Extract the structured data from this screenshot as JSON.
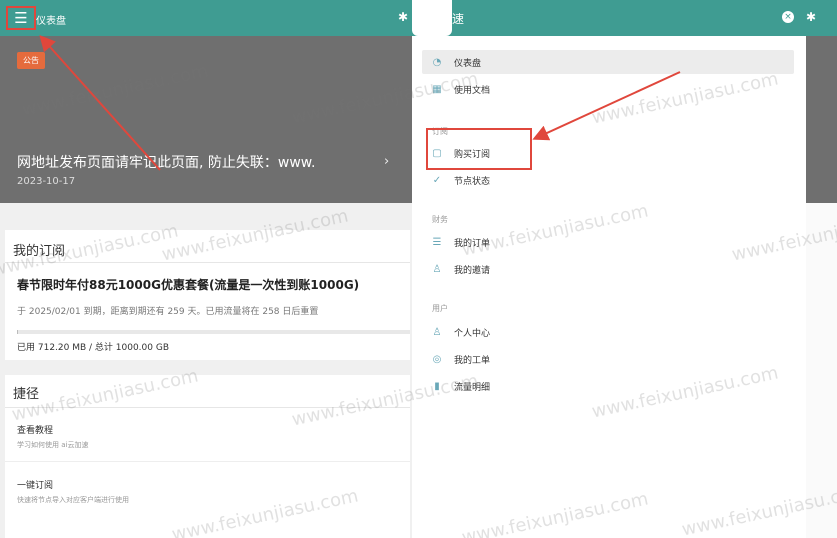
{
  "topbar": {
    "brand": "仪表盘",
    "menu_icon": "☰",
    "settings_icon": "✱"
  },
  "hero": {
    "badge": "公告",
    "title": "网地址发布页面请牢记此页面, 防止失联：www.",
    "date": "2023-10-17",
    "next_icon": "›"
  },
  "subscription": {
    "header": "我的订阅",
    "plan_name": "春节限时年付88元1000G优惠套餐(流量是一次性到账1000G)",
    "info": "于 2025/02/01 到期，距离到期还有 259 天。已用流量将在 258 日后重置",
    "usage": "已用 712.20 MB / 总计 1000.00 GB",
    "used_fraction": 0.0007
  },
  "shortcuts": {
    "header": "捷径",
    "items": [
      {
        "title": "查看教程",
        "desc": "学习如何使用 ai云加速"
      },
      {
        "title": "一键订阅",
        "desc": "快速将节点导入对应客户端进行使用"
      }
    ]
  },
  "drawer": {
    "title": "速",
    "close_icon": "×",
    "items_top": [
      {
        "label": "仪表盘",
        "icon": "◔",
        "active": true
      },
      {
        "label": "使用文档",
        "icon": "▦",
        "active": false
      }
    ],
    "section_subscribe": "订阅",
    "items_subscribe": [
      {
        "label": "购买订阅",
        "icon": "▢"
      },
      {
        "label": "节点状态",
        "icon": "✓"
      }
    ],
    "section_finance": "财务",
    "items_finance": [
      {
        "label": "我的订单",
        "icon": "☰"
      },
      {
        "label": "我的邀请",
        "icon": "♙"
      }
    ],
    "section_user": "用户",
    "items_user": [
      {
        "label": "个人中心",
        "icon": "♙"
      },
      {
        "label": "我的工单",
        "icon": "◎"
      },
      {
        "label": "流量明细",
        "icon": "▮"
      }
    ]
  },
  "watermark": "www.feixunjiasu.com",
  "colors": {
    "header": "#3f9c92",
    "annotation": "#e0473c",
    "badge": "#e56b3d"
  }
}
